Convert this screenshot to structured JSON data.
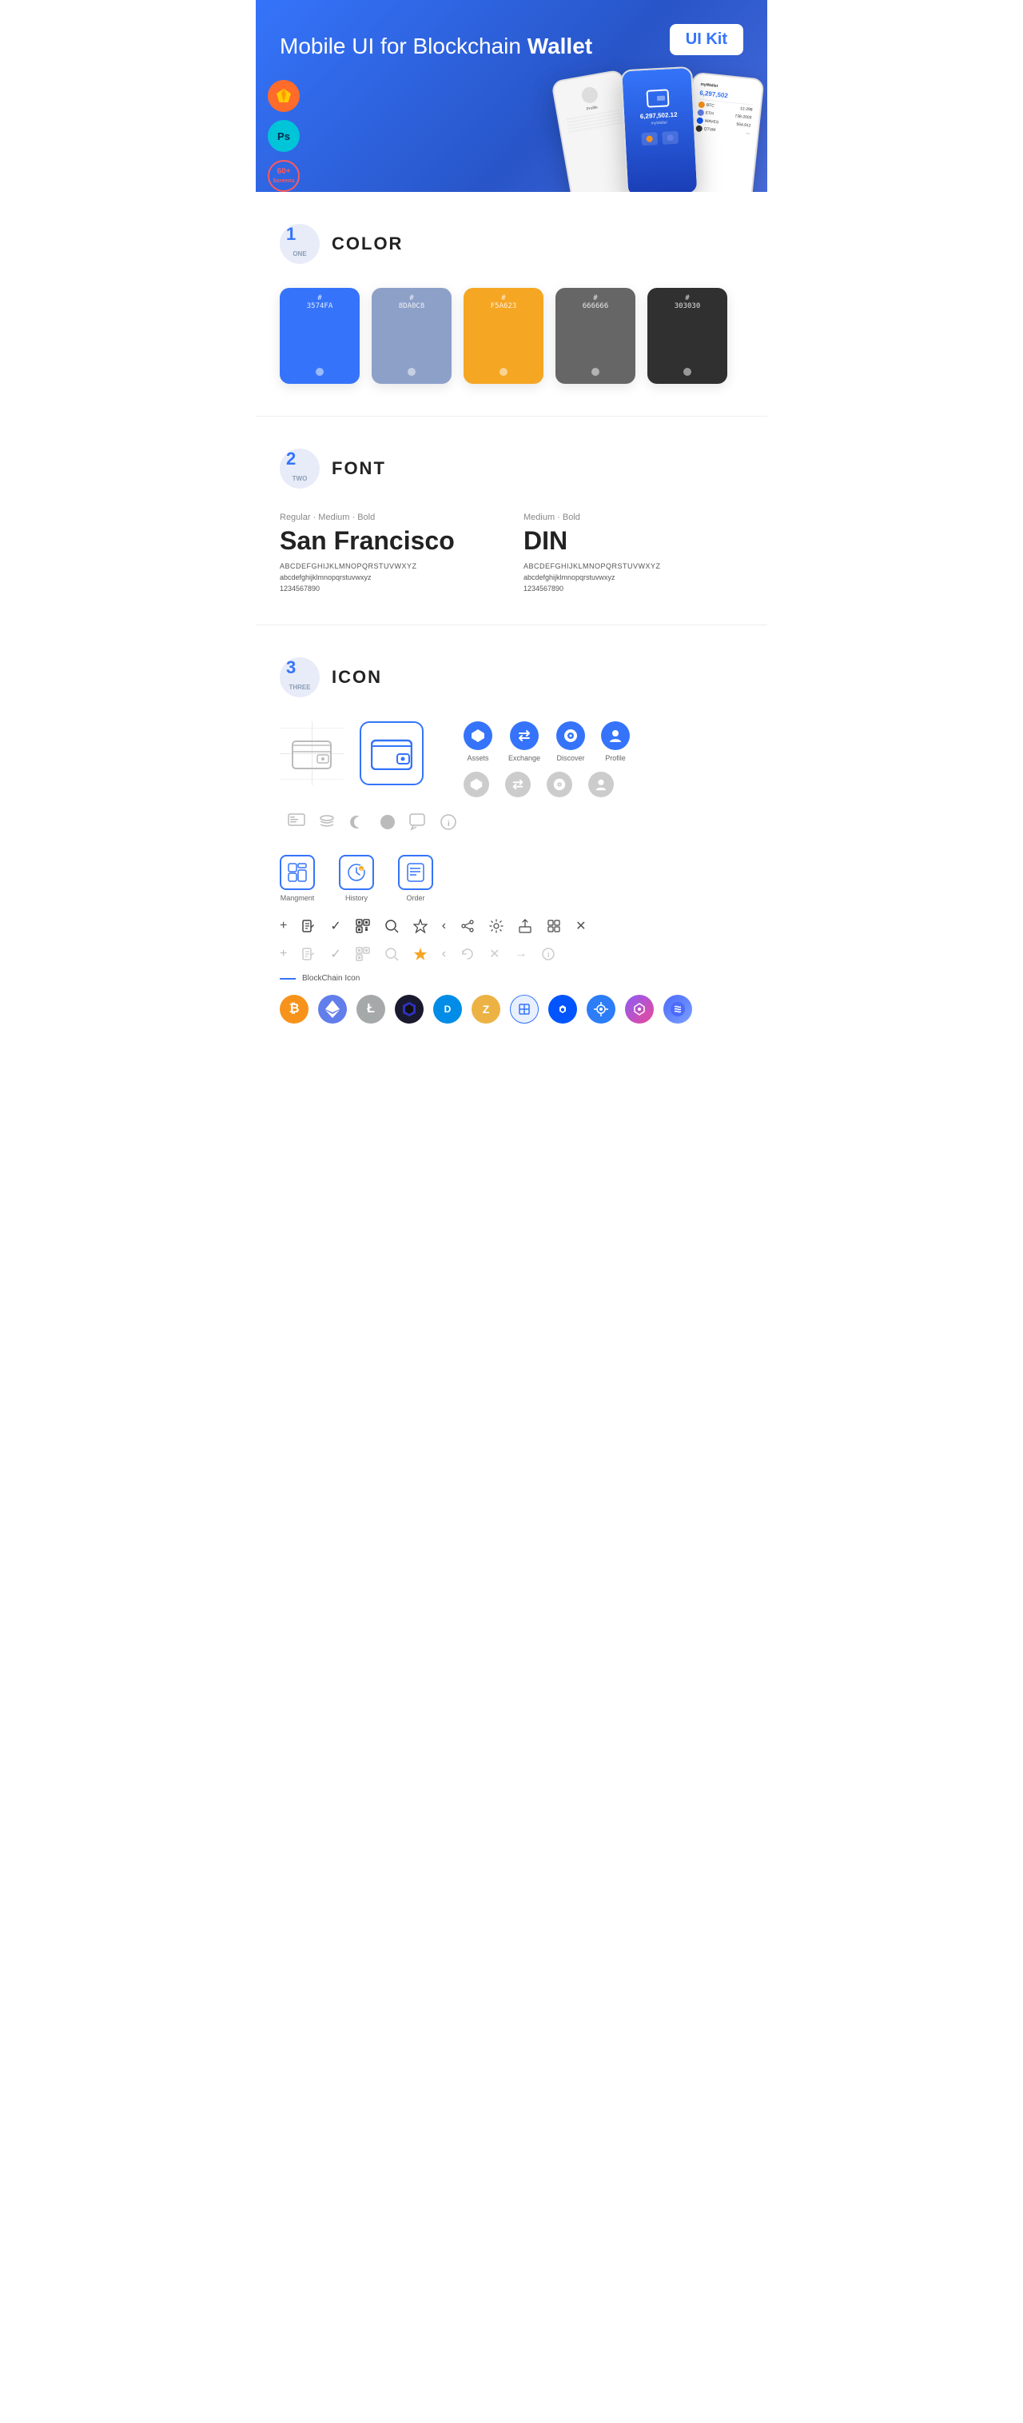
{
  "hero": {
    "title": "Mobile UI for Blockchain ",
    "title_bold": "Wallet",
    "badge": "UI Kit",
    "sketch_label": "Sk",
    "ps_label": "Ps",
    "screens_label": "60+\nScreens"
  },
  "sections": {
    "color": {
      "number": "1",
      "number_word": "ONE",
      "title": "COLOR",
      "swatches": [
        {
          "hex": "#3574FA",
          "label": "3574FA"
        },
        {
          "hex": "#8DA0C8",
          "label": "8DA0C8"
        },
        {
          "hex": "#F5A623",
          "label": "F5A623"
        },
        {
          "hex": "#666666",
          "label": "666666"
        },
        {
          "hex": "#303030",
          "label": "303030"
        }
      ]
    },
    "font": {
      "number": "2",
      "number_word": "TWO",
      "title": "FONT",
      "fonts": [
        {
          "weights": "Regular · Medium · Bold",
          "name": "San Francisco",
          "uppercase": "ABCDEFGHIJKLMNOPQRSTUVWXYZ",
          "lowercase": "abcdefghijklmnopqrstuvwxyz",
          "numbers": "1234567890"
        },
        {
          "weights": "Medium · Bold",
          "name": "DIN",
          "uppercase": "ABCDEFGHIJKLMNOPQRSTUVWXYZ",
          "lowercase": "abcdefghijklmnopqrstuvwxyz",
          "numbers": "1234567890"
        }
      ]
    },
    "icon": {
      "number": "3",
      "number_word": "THREE",
      "title": "ICON",
      "nav_icons": [
        {
          "label": "Assets",
          "color": "blue"
        },
        {
          "label": "Exchange",
          "color": "blue"
        },
        {
          "label": "Discover",
          "color": "blue"
        },
        {
          "label": "Profile",
          "color": "blue"
        }
      ],
      "management_icons": [
        {
          "label": "Mangment"
        },
        {
          "label": "History"
        },
        {
          "label": "Order"
        }
      ],
      "blockchain_label": "BlockChain Icon",
      "crypto_icons": [
        {
          "symbol": "₿",
          "label": "BTC",
          "color": "#F7931A"
        },
        {
          "symbol": "Ξ",
          "label": "ETH",
          "color": "#627EEA"
        },
        {
          "symbol": "Ł",
          "label": "LTC",
          "color": "#A6A9AA"
        },
        {
          "symbol": "◆",
          "label": "BLK",
          "color": "#1a1a1a"
        },
        {
          "symbol": "D",
          "label": "DASH",
          "color": "#008CE7"
        },
        {
          "symbol": "Z",
          "label": "ZEC",
          "color": "#ECB244"
        },
        {
          "symbol": "⬡",
          "label": "GRID",
          "color": "#4A90D9"
        },
        {
          "symbol": "▲",
          "label": "WAVES",
          "color": "#0055FF"
        },
        {
          "symbol": "◈",
          "label": "XTZ",
          "color": "#2C7DF7"
        },
        {
          "symbol": "◈",
          "label": "POLY",
          "color": "#7B3FE4"
        },
        {
          "symbol": "⬡",
          "label": "BAND",
          "color": "#4B6BFB"
        }
      ]
    }
  }
}
